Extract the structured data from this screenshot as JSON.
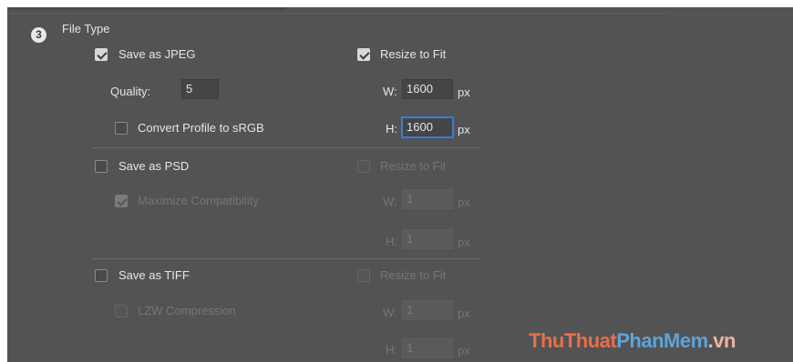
{
  "section": {
    "step": "3",
    "title": "File Type"
  },
  "jpeg": {
    "label": "Save as JPEG",
    "checked": true,
    "quality_label": "Quality:",
    "quality_value": "5",
    "convert_label": "Convert Profile to sRGB",
    "convert_checked": false,
    "resize_label": "Resize to Fit",
    "resize_checked": true,
    "w_label": "W:",
    "w_value": "1600",
    "h_label": "H:",
    "h_value": "1600",
    "unit": "px"
  },
  "psd": {
    "label": "Save as PSD",
    "checked": false,
    "maximize_label": "Maximize Compatibility",
    "maximize_checked": true,
    "resize_label": "Resize to Fit",
    "resize_checked": false,
    "w_label": "W:",
    "w_value": "1",
    "h_label": "H:",
    "h_value": "1",
    "unit": "px"
  },
  "tiff": {
    "label": "Save as TIFF",
    "checked": false,
    "lzw_label": "LZW Compression",
    "lzw_checked": false,
    "resize_label": "Resize to Fit",
    "resize_checked": false,
    "w_label": "W:",
    "w_value": "1",
    "h_label": "H:",
    "h_value": "1",
    "unit": "px"
  },
  "watermark": {
    "part1": "Thu",
    "part2": "Thuat",
    "part3": "PhanMem",
    "part4": ".vn"
  }
}
